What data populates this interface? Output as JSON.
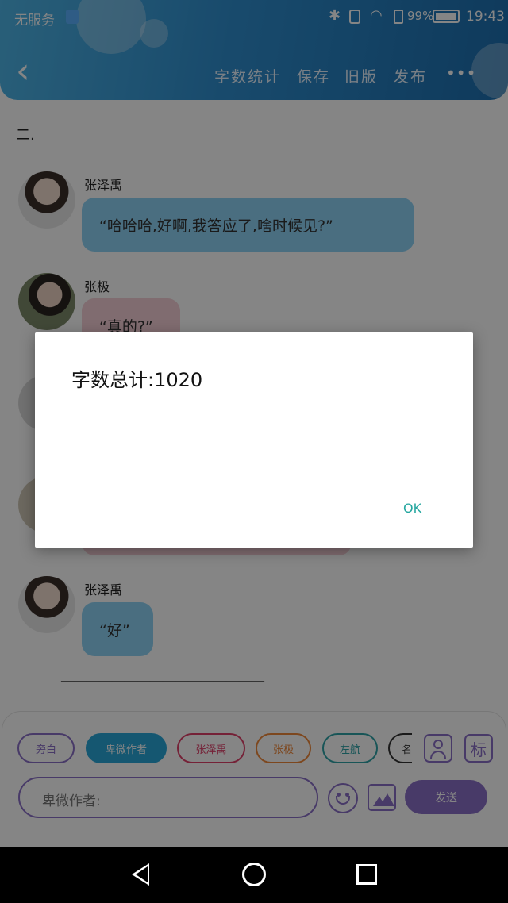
{
  "status_bar": {
    "carrier": "无服务",
    "battery": "99%",
    "time": "19:43"
  },
  "header": {
    "back_label": "‹",
    "actions": [
      "字数统计",
      "保存",
      "旧版",
      "发布"
    ],
    "more": "•••"
  },
  "content": {
    "section_label": "二.",
    "messages": [
      {
        "name": "张泽禹",
        "text": "“哈哈哈,好啊,我答应了,啥时候见?”"
      },
      {
        "name": "张极",
        "text": "“真的?”"
      },
      {
        "name": "张泽禹",
        "text": "“好”"
      }
    ],
    "divider": "————————————————"
  },
  "toolbar": {
    "chips": [
      {
        "label": "旁白",
        "color": "#8b6fc7"
      },
      {
        "label": "卑微作者",
        "color": "#29a8d9"
      },
      {
        "label": "张泽禹",
        "color": "#e0406a"
      },
      {
        "label": "张极",
        "color": "#f0883a"
      },
      {
        "label": "左航",
        "color": "#2ea3a8"
      },
      {
        "label": "名",
        "color": "#333333"
      }
    ],
    "input_placeholder": "卑微作者:",
    "send_label": "发送",
    "mark_label": "标"
  },
  "dialog": {
    "message": "字数总计:1020",
    "ok_label": "OK"
  },
  "colors": {
    "accent_purple": "#8b6fc7",
    "header_blue": "#2f8fd0",
    "ok_teal": "#26a7a0"
  }
}
